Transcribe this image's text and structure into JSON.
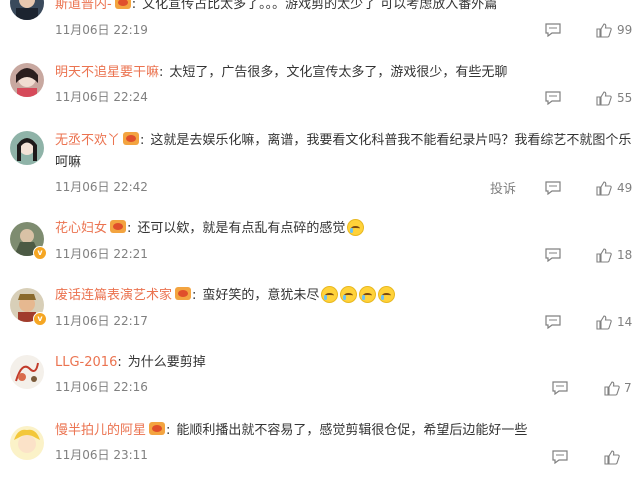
{
  "comments": [
    {
      "username": "斯道普内-",
      "text": "文化宣传占比太多了。。。游戏剪的太少了 可以考虑放入番外篇",
      "time": "11月06日 22:19",
      "likes": "99",
      "avatar_icon": "avatar-icon"
    },
    {
      "username": "明天不追星要干嘛",
      "text": "太短了，广告很多，文化宣传太多了，游戏很少，有些无聊",
      "time": "11月06日 22:24",
      "likes": "55",
      "avatar_icon": "avatar-icon"
    },
    {
      "username": "无丞不欢丫",
      "text": "这就是去娱乐化嘛，离谱，我要看文化科普我不能看纪录片吗？我看综艺不就图个乐呵嘛",
      "time": "11月06日 22:42",
      "likes": "49",
      "report_label": "投诉",
      "avatar_icon": "avatar-icon"
    },
    {
      "username": "花心妇女",
      "text": "还可以欸，就是有点乱有点碎的感觉",
      "time": "11月06日 22:21",
      "likes": "18",
      "avatar_icon": "avatar-icon"
    },
    {
      "username": "废话连篇表演艺术家",
      "text": "蛮好笑的，意犹未尽",
      "time": "11月06日 22:17",
      "likes": "14",
      "avatar_icon": "avatar-icon"
    },
    {
      "username": "LLG-2016",
      "text": "为什么要剪掉",
      "time": "11月06日 22:16",
      "likes": "7",
      "avatar_icon": "avatar-icon"
    },
    {
      "username": "慢半拍儿的阿星",
      "text": "能顺利播出就不容易了，感觉剪辑很仓促，希望后边能好一些",
      "time": "11月06日 23:11",
      "likes": "",
      "avatar_icon": "avatar-icon"
    }
  ],
  "colors": {
    "username": "#eb7350",
    "meta": "#808080",
    "text": "#333333"
  }
}
